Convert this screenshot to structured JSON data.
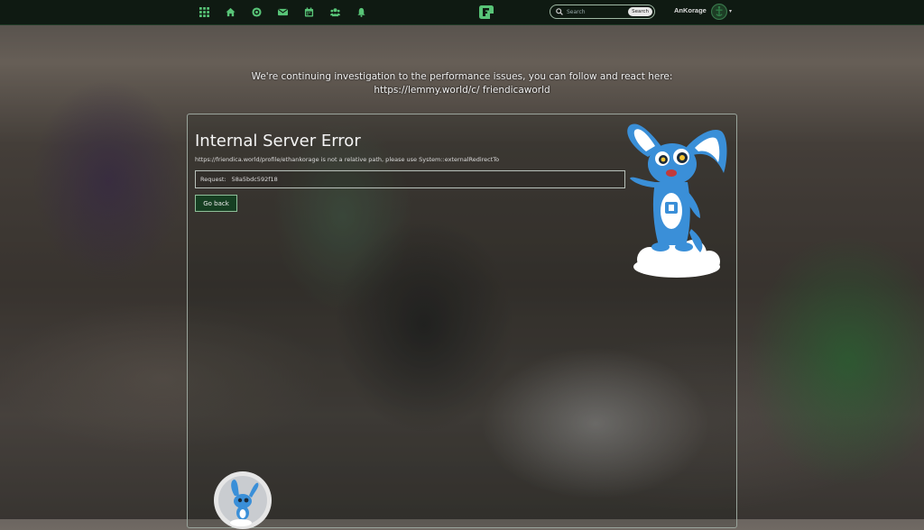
{
  "navbar": {
    "icons": [
      "apps-grid-icon",
      "home-icon",
      "network-icon",
      "mail-icon",
      "calendar-icon",
      "contacts-icon",
      "notifications-icon"
    ],
    "brand_color": "#58c477",
    "search": {
      "placeholder": "Search",
      "button_label": "Search"
    },
    "user_name": "AnKorage"
  },
  "announcement": "We're continuing investigation to the performance issues, you can follow and react here: https://lemmy.world/c/ friendicaworld",
  "error": {
    "title": "Internal Server Error",
    "message": "https://friendica.world/profile/ethankorage is not a relative path, please use System::externalRedirectTo",
    "request_label": "Request:",
    "request_id": "58a5bdc592f18",
    "go_back_label": "Go back"
  }
}
